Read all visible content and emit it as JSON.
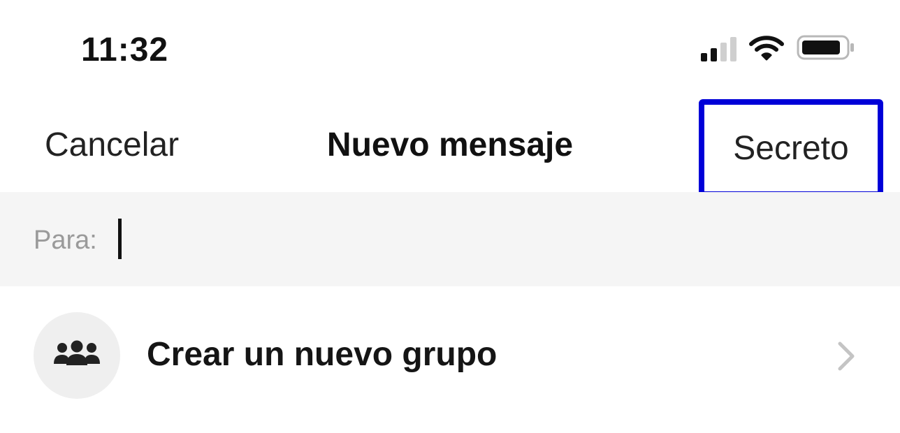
{
  "status_bar": {
    "time": "11:32",
    "icons": [
      "signal-icon",
      "wifi-icon",
      "battery-icon"
    ]
  },
  "nav": {
    "cancel_label": "Cancelar",
    "title": "Nuevo mensaje",
    "secret_label": "Secreto",
    "highlight_color": "#0000d8"
  },
  "to_field": {
    "label": "Para:",
    "value": ""
  },
  "actions": {
    "create_group_label": "Crear un nuevo grupo",
    "icon": "group-icon",
    "chevron": "chevron-right-icon"
  }
}
